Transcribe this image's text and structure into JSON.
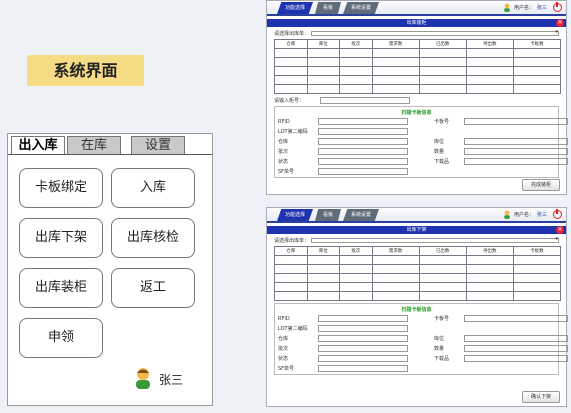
{
  "heading": "系统界面",
  "device": {
    "tabs": [
      "出入库",
      "在库",
      "设置"
    ],
    "buttons": [
      "卡板绑定",
      "入库",
      "出库下架",
      "出库核检",
      "出库装柜",
      "返工",
      "申领"
    ],
    "user": "张三"
  },
  "windows": [
    {
      "menu": [
        "功能选择",
        "看板",
        "系统设置"
      ],
      "account_label": "用户名：",
      "account_name": "张三",
      "title": "出库装柜",
      "select_label": "请选择出库单：",
      "columns": [
        "仓库",
        "库位",
        "批次",
        "需求数",
        "已出数",
        "待出数",
        "卡板数"
      ],
      "input_label": "请输入柜号：",
      "scan_title": "扫描卡板信息",
      "left_fields": [
        "RFID",
        "LOT第二编码",
        "仓库",
        "批次",
        "状态",
        "SF单号"
      ],
      "right_fields": [
        "卡板号",
        "",
        "库位",
        "数量",
        "下载品",
        ""
      ],
      "action": "完成装柜"
    },
    {
      "menu": [
        "功能选择",
        "看板",
        "系统设置"
      ],
      "account_label": "用户名：",
      "account_name": "张三",
      "title": "出库下架",
      "select_label": "请选择出库单：",
      "columns": [
        "仓库",
        "库位",
        "批次",
        "需求数",
        "已出数",
        "待出数",
        "卡板数"
      ],
      "scan_title": "扫描卡板信息",
      "left_fields": [
        "RFID",
        "LOT第二编码",
        "仓库",
        "批次",
        "状态",
        "SF单号"
      ],
      "right_fields": [
        "卡板号",
        "",
        "库位",
        "数量",
        "下载品",
        ""
      ],
      "action": "确认下架"
    }
  ],
  "colors": {
    "accent": "#1f33b0",
    "badge": "#f7dc86",
    "close": "#e22233"
  },
  "icons": [
    "user-avatar-icon",
    "power-icon",
    "close-icon",
    "dropdown-arrow-icon"
  ]
}
